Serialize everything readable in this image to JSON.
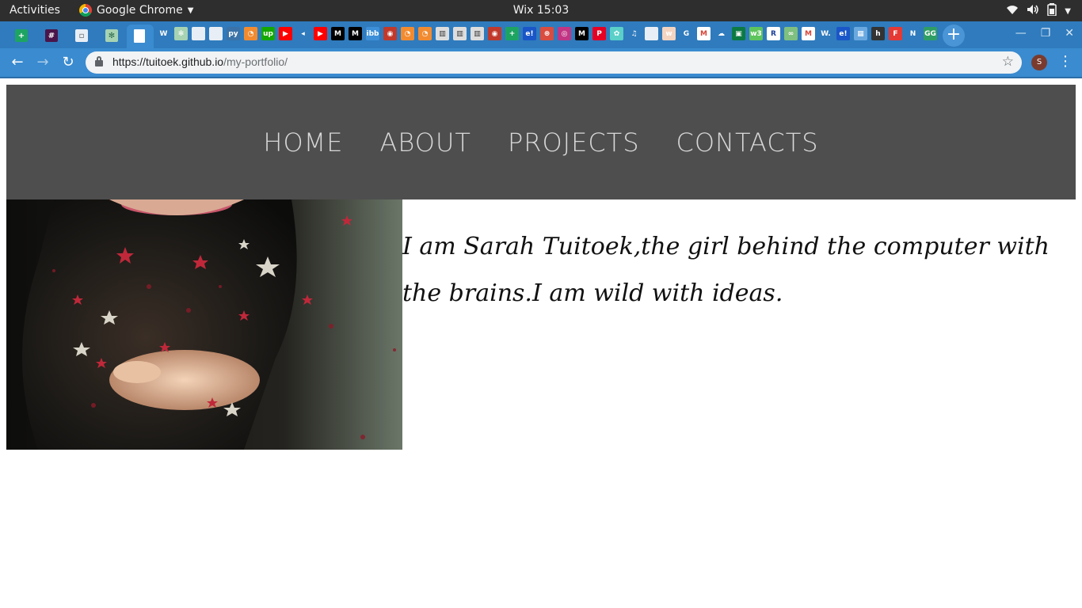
{
  "system_bar": {
    "activities_label": "Activities",
    "app_name": "Google Chrome",
    "clock": "Wix 15:03"
  },
  "browser": {
    "url_host": "https://tuitoek.github.io",
    "url_path": "/my-portfolio/",
    "profile_initial": "S"
  },
  "site": {
    "nav": [
      {
        "label": "HOME"
      },
      {
        "label": "ABOUT"
      },
      {
        "label": "PROJECTS"
      },
      {
        "label": "CONTACTS"
      }
    ],
    "intro_text": "I am Sarah Tuitoek,the girl behind the computer with the brains.I am wild with ideas."
  },
  "colors": {
    "tab_strip": "#2f7bbd",
    "toolbar": "#3a8bd0",
    "site_nav_bg": "#4e4e4e",
    "site_nav_text": "#d8d8d8"
  }
}
